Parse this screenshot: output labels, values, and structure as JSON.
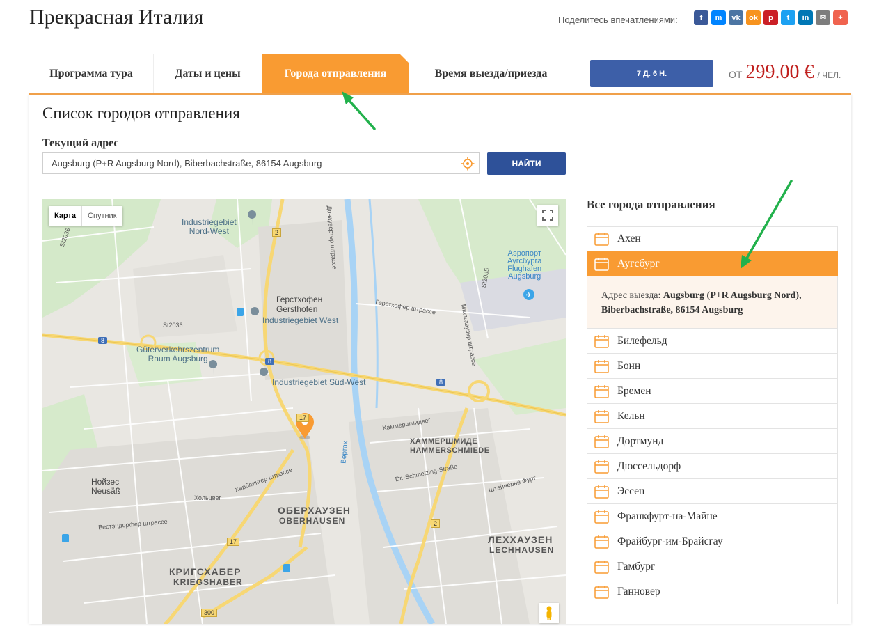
{
  "header": {
    "title": "Прекрасная Италия",
    "share_label": "Поделитесь впечатлениями:",
    "share_icons": [
      {
        "name": "facebook-icon",
        "glyph": "f",
        "color": "#3b5998"
      },
      {
        "name": "messenger-icon",
        "glyph": "m",
        "color": "#0084ff"
      },
      {
        "name": "vk-icon",
        "glyph": "vk",
        "color": "#4c75a3"
      },
      {
        "name": "odnoklassniki-icon",
        "glyph": "ok",
        "color": "#f7931e"
      },
      {
        "name": "pinterest-icon",
        "glyph": "p",
        "color": "#cb2027"
      },
      {
        "name": "twitter-icon",
        "glyph": "t",
        "color": "#1da1f2"
      },
      {
        "name": "linkedin-icon",
        "glyph": "in",
        "color": "#0077b5"
      },
      {
        "name": "email-icon",
        "glyph": "✉",
        "color": "#7d7d7d"
      },
      {
        "name": "more-icon",
        "glyph": "+",
        "color": "#f0634f"
      }
    ]
  },
  "tabs": [
    {
      "label": "Программа тура",
      "active": false
    },
    {
      "label": "Даты и цены",
      "active": false
    },
    {
      "label": "Города отправления",
      "active": true
    },
    {
      "label": "Время выезда/приезда",
      "active": false
    }
  ],
  "duration_label": "7 Д. 6 Н.",
  "price": {
    "from": "ОТ",
    "amount": "299.00 €",
    "per": "/ ЧЕЛ."
  },
  "main": {
    "heading": "Список городов отправления",
    "address_label": "Текущий адрес",
    "address_value": "Augsburg (P+R Augsburg Nord), Biberbachstraße, 86154 Augsburg",
    "find_button": "НАЙТИ"
  },
  "map": {
    "toggle_map": "Карта",
    "toggle_satellite": "Спутник",
    "labels": {
      "ind_nordwest": "Industriegebiet\nNord-West",
      "airport": "Аэропорт\nАугсбурга\nFlughafen\nAugsburg",
      "gersthofen_ru": "Герстхофен",
      "gersthofen_de": "Gersthofen",
      "ind_west": "Industriegebiet West",
      "gvz": "Güterverkehrszentrum\nRaum Augsburg",
      "ind_sudwest": "Industriegebiet Süd-West",
      "hammer_ru": "ХАММЕРШМИДЕ",
      "hammer_de": "HAMMERSCHMIEDE",
      "neusass": "Нойзес\nNeusäß",
      "oberhausen_ru": "ОБЕРХАУЗЕН",
      "oberhausen_de": "OBERHAUSEN",
      "lechhausen_ru": "ЛЕХХАУЗЕН",
      "lechhausen_de": "LECHHAUSEN",
      "kriegshaber_ru": "КРИГСХАБЕР",
      "kriegshaber_de": "KRIEGSHABER",
      "st2036": "St2036",
      "st2036b": "St2036",
      "st2035": "St2035",
      "road8a": "8",
      "road8b": "8",
      "road8c": "8",
      "road2": "2",
      "road2b": "2",
      "road17": "17",
      "road17b": "17",
      "road300": "300",
      "wertach": "Вертах",
      "gersthofer": "Герстхофер штрассе",
      "hirblinger": "Хирблингер штрассе",
      "holzweg": "Хольцвег",
      "westendorfer": "Вестэндорфер штрассе",
      "donauworther": "Донаувертер штрассе",
      "hammerschmied": "Хаммершмидвег",
      "schmelzing": "Dr.-Schmelzing-Straße",
      "stauden": "Штайнерне Фурт",
      "muhlhauser": "Мюльхаузер штрассе"
    }
  },
  "sidebar": {
    "title": "Все города отправления",
    "cities_top": [
      "Ахен",
      "Аугсбург"
    ],
    "detail_prefix": "Адрес выезда:",
    "detail_value": "Augsburg (P+R Augsburg Nord), Biberbachstraße, 86154 Augsburg",
    "cities_rest": [
      "Билефельд",
      "Бонн",
      "Бремен",
      "Кельн",
      "Дортмунд",
      "Дюссельдорф",
      "Эссен",
      "Франкфурт-на-Майне",
      "Фрайбург-им-Брайсгау",
      "Гамбург",
      "Ганновер"
    ]
  },
  "colors": {
    "accent": "#f99b32",
    "button_blue": "#2e5199",
    "price_red": "#c0201e",
    "annotation_arrow": "#22b14c"
  }
}
